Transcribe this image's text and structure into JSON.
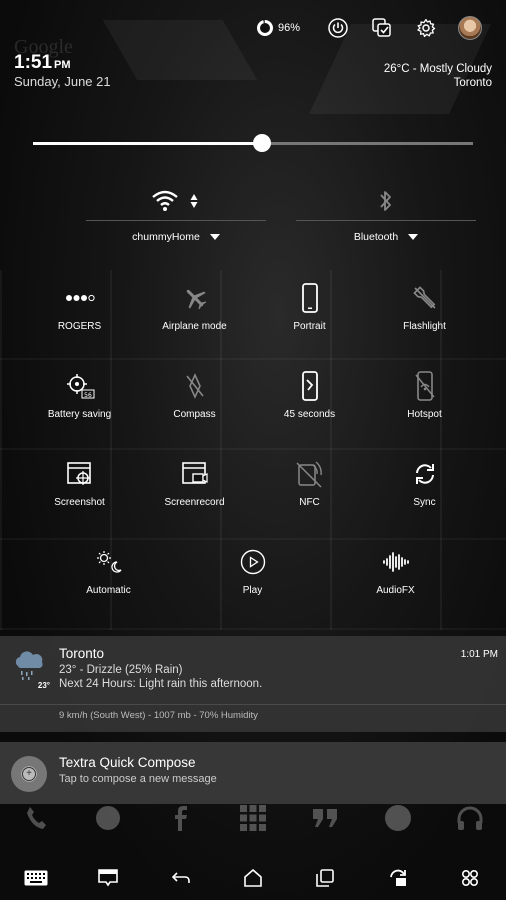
{
  "status": {
    "battery_percent": "96%",
    "battery_level": 0.96
  },
  "header": {
    "ghost_text": "Google",
    "time": "1:51",
    "ampm": "PM",
    "date": "Sunday, June 21",
    "weather_line": "26°C - Mostly Cloudy",
    "location": "Toronto"
  },
  "brightness": {
    "level": 0.52
  },
  "connections": {
    "wifi": {
      "label": "chummyHome",
      "icon": "wifi-icon"
    },
    "bluetooth": {
      "label": "Bluetooth",
      "icon": "bluetooth-icon"
    }
  },
  "tiles": [
    {
      "label": "ROGERS",
      "icon": "signal-dots-icon"
    },
    {
      "label": "Airplane mode",
      "icon": "airplane-icon"
    },
    {
      "label": "Portrait",
      "icon": "rotation-lock-icon"
    },
    {
      "label": "Flashlight",
      "icon": "flashlight-icon"
    },
    {
      "label": "Battery saving",
      "icon": "battery-saver-icon"
    },
    {
      "label": "Compass",
      "icon": "compass-icon"
    },
    {
      "label": "45 seconds",
      "icon": "screen-timeout-icon"
    },
    {
      "label": "Hotspot",
      "icon": "hotspot-icon"
    },
    {
      "label": "Screenshot",
      "icon": "screenshot-icon"
    },
    {
      "label": "Screenrecord",
      "icon": "screenrecord-icon"
    },
    {
      "label": "NFC",
      "icon": "nfc-icon"
    },
    {
      "label": "Sync",
      "icon": "sync-icon"
    },
    {
      "label": "Automatic",
      "icon": "auto-brightness-icon"
    },
    {
      "label": "Play",
      "icon": "play-icon"
    },
    {
      "label": "AudioFX",
      "icon": "audiofx-icon"
    }
  ],
  "notifications": {
    "weather": {
      "title": "Toronto",
      "time": "1:01 PM",
      "line1": "23° - Drizzle (25% Rain)",
      "line2": "Next 24 Hours: Light rain this afternoon.",
      "footer": "9 km/h (South West) - 1007 mb - 70% Humidity",
      "icon_temp": "23°"
    },
    "textra": {
      "title": "Textra Quick Compose",
      "subtitle": "Tap to compose a new message",
      "icon_glyph": "+"
    }
  },
  "dock": [
    "phone-icon",
    "whatsapp-icon",
    "facebook-icon",
    "app-drawer-icon",
    "hangouts-icon",
    "tumblr-icon",
    "headphones-icon"
  ],
  "navbar": [
    "keyboard-icon",
    "notification-icon",
    "back-icon",
    "home-icon",
    "recents-icon",
    "rotate-icon",
    "menu-icon"
  ],
  "colors": {
    "accent": "#ffffff",
    "panel": "#343434",
    "background": "#0a0a0a"
  }
}
